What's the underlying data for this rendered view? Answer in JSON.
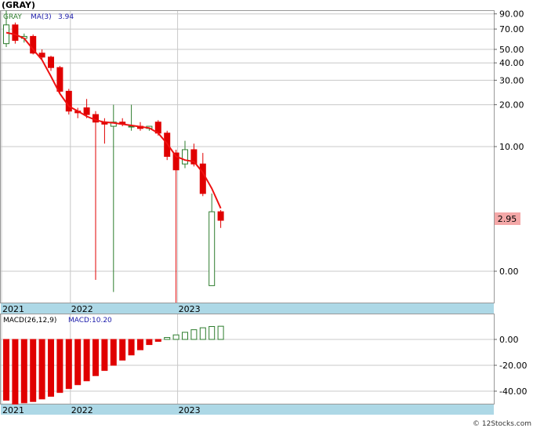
{
  "header": {
    "ticker": "(GRAY)"
  },
  "footer": {
    "credit": "© 12Stocks.com"
  },
  "colors": {
    "up": "#2e7d2e",
    "down": "#e00000",
    "ma": "#ee1111",
    "axis_band": "#add8e6",
    "grid": "#c8c8c8",
    "price_label_bg": "#f4a8a8",
    "legend_blue": "#1a1aaa"
  },
  "chart_data": [
    {
      "type": "candlestick",
      "legend": {
        "symbol": "GRAY",
        "ma_label": "MA(3)",
        "ma_value": "3.94"
      },
      "scale": "log",
      "y_ticks": [
        "90.00",
        "70.00",
        "50.00",
        "40.00",
        "30.00",
        "20.00",
        "10.00",
        "0.00"
      ],
      "x_ticks": [
        "2021",
        "2022",
        "2023"
      ],
      "last_price_label": "2.95",
      "candles": [
        {
          "date": "2020-12",
          "o": 55,
          "h": 95,
          "l": 52,
          "c": 75
        },
        {
          "date": "2021-01",
          "o": 75,
          "h": 78,
          "l": 55,
          "c": 58
        },
        {
          "date": "2021-02",
          "o": 60,
          "h": 65,
          "l": 56,
          "c": 62
        },
        {
          "date": "2021-03",
          "o": 62,
          "h": 64,
          "l": 46,
          "c": 47
        },
        {
          "date": "2021-04",
          "o": 47,
          "h": 50,
          "l": 42,
          "c": 44
        },
        {
          "date": "2021-05",
          "o": 44,
          "h": 45,
          "l": 35,
          "c": 37
        },
        {
          "date": "2021-06",
          "o": 37,
          "h": 38,
          "l": 24,
          "c": 25
        },
        {
          "date": "2021-07",
          "o": 25,
          "h": 26,
          "l": 17,
          "c": 18
        },
        {
          "date": "2021-08",
          "o": 18,
          "h": 19,
          "l": 16,
          "c": 17.5
        },
        {
          "date": "2021-09",
          "o": 19,
          "h": 22,
          "l": 16,
          "c": 17
        },
        {
          "date": "2021-10",
          "o": 17,
          "h": 18,
          "l": 1.1,
          "c": 15
        },
        {
          "date": "2021-11",
          "o": 15,
          "h": 16,
          "l": 10.5,
          "c": 14.5
        },
        {
          "date": "2021-12",
          "o": 14,
          "h": 20,
          "l": 0.9,
          "c": 15
        },
        {
          "date": "2022-01",
          "o": 15,
          "h": 16,
          "l": 14,
          "c": 14.5
        },
        {
          "date": "2022-02",
          "o": 14,
          "h": 20,
          "l": 13,
          "c": 14
        },
        {
          "date": "2022-03",
          "o": 14,
          "h": 15,
          "l": 13,
          "c": 13.5
        },
        {
          "date": "2022-04",
          "o": 13.5,
          "h": 14,
          "l": 13,
          "c": 14
        },
        {
          "date": "2022-05",
          "o": 15,
          "h": 15.5,
          "l": 12,
          "c": 12.5
        },
        {
          "date": "2022-06",
          "o": 12.5,
          "h": 13,
          "l": 8,
          "c": 8.5
        },
        {
          "date": "2022-07",
          "o": 9,
          "h": 9.5,
          "l": 0.5,
          "c": 6.8
        },
        {
          "date": "2022-08",
          "o": 7.5,
          "h": 11,
          "l": 7,
          "c": 9.5
        },
        {
          "date": "2022-09",
          "o": 9.5,
          "h": 10.5,
          "l": 7.2,
          "c": 7.5
        },
        {
          "date": "2022-10",
          "o": 7.5,
          "h": 9,
          "l": 4.4,
          "c": 4.6
        },
        {
          "date": "2022-11",
          "o": 1.0,
          "h": 4.6,
          "l": 1.0,
          "c": 3.4
        },
        {
          "date": "2022-12",
          "o": 3.4,
          "h": 3.5,
          "l": 2.6,
          "c": 2.95
        }
      ],
      "ma_values": [
        66,
        64,
        60,
        50,
        42,
        32,
        24,
        19.5,
        18,
        16.5,
        15.5,
        15,
        14.8,
        14.5,
        14.2,
        13.9,
        13.6,
        12.5,
        10.5,
        8.5,
        8,
        7.8,
        6.5,
        5,
        3.6
      ]
    },
    {
      "type": "bar",
      "legend": {
        "label": "MACD(26,12,9)",
        "macd_label": "MACD:10.20"
      },
      "y_ticks": [
        "0.00",
        "-20.00",
        "-40.00"
      ],
      "ylim": [
        -50,
        15
      ],
      "x_ticks": [
        "2021",
        "2022",
        "2023"
      ],
      "values": [
        -47,
        -50,
        -49,
        -48,
        -46,
        -44,
        -41,
        -38,
        -35,
        -32,
        -28,
        -24,
        -20,
        -16,
        -12,
        -8,
        -4,
        -1.5,
        1.5,
        3.5,
        5.5,
        7.5,
        9,
        10,
        10.2
      ]
    }
  ]
}
